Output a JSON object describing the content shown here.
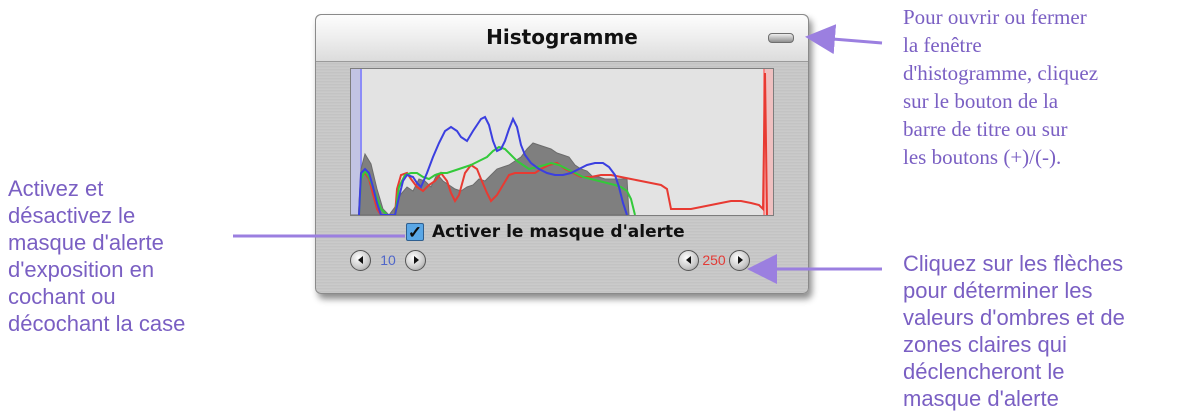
{
  "window": {
    "title": "Histogramme"
  },
  "histogram": {
    "series_colors": {
      "gray": "#7f7f7f",
      "red": "#e83a32",
      "green": "#33c93a",
      "blue": "#3b3fe0"
    }
  },
  "mask_toggle": {
    "label": "Activer le masque d'alerte",
    "checked": true
  },
  "shadow_stepper": {
    "value": "10"
  },
  "highlight_stepper": {
    "value": "250"
  },
  "callouts": {
    "left": [
      "Activez et",
      "désactivez le",
      "masque d'alerte",
      "d'exposition en",
      "cochant ou",
      "décochant la case"
    ],
    "top_right": [
      "Pour ouvrir ou fermer",
      "la fenêtre",
      "d'histogramme, cliquez",
      "sur le bouton de la",
      "barre de titre ou sur",
      "les boutons (+)/(-)."
    ],
    "bottom_right": [
      "Cliquez sur les flèches",
      "pour déterminer les",
      "valeurs d'ombres et de",
      "zones claires qui",
      "déclencheront le",
      "masque d'alerte"
    ],
    "color": "#7a5fc3"
  }
}
